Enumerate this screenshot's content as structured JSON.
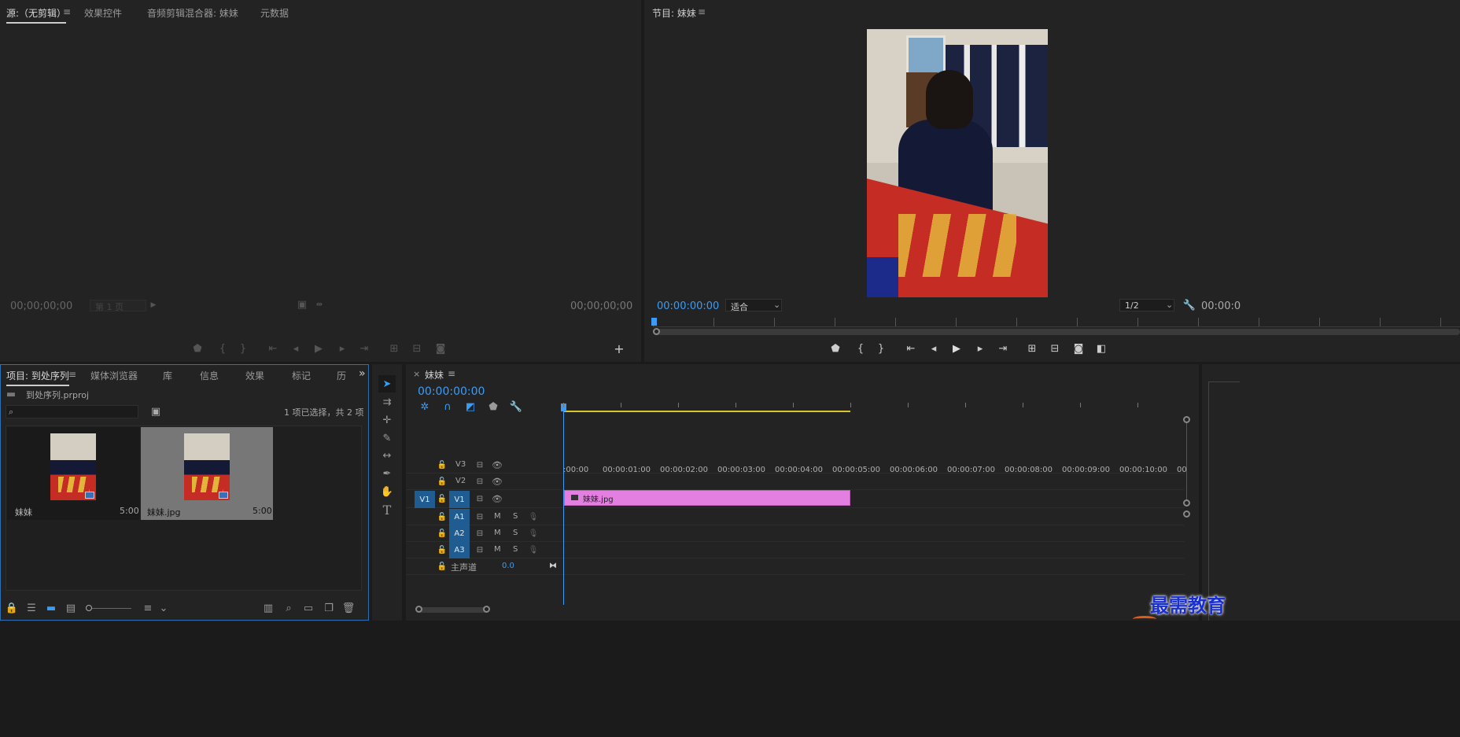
{
  "source_panel": {
    "tabs": [
      "源:（无剪辑）",
      "效果控件",
      "音频剪辑混合器: 妹妹",
      "元数据"
    ],
    "tab_menu_icon": "≡",
    "timecode_left": "00;00;00;00",
    "page_select": "第 1 页",
    "timecode_right": "00;00;00;00"
  },
  "program_panel": {
    "title": "节目: 妹妹",
    "menu_icon": "≡",
    "timecode": "00:00:00:00",
    "fit": "适合",
    "resolution": "1/2",
    "timecode_right": "00:00:0"
  },
  "project_panel": {
    "tabs": [
      "项目: 到处序列",
      "媒体浏览器",
      "库",
      "信息",
      "效果",
      "标记",
      "历"
    ],
    "menu_icon": "≡",
    "more_icon": "»",
    "file": "到处序列.prproj",
    "search_placeholder": "",
    "selection_status": "1 项已选择，共 2 项",
    "items": [
      {
        "name": "妹妹",
        "duration": "5:00",
        "selected": false
      },
      {
        "name": "妹妹.jpg",
        "duration": "5:00",
        "selected": true
      }
    ]
  },
  "timeline": {
    "close": "×",
    "sequence": "妹妹",
    "menu_icon": "≡",
    "timecode": "00:00:00:00",
    "ruler": [
      ":00:00",
      "00:00:01:00",
      "00:00:02:00",
      "00:00:03:00",
      "00:00:04:00",
      "00:00:05:00",
      "00:00:06:00",
      "00:00:07:00",
      "00:00:08:00",
      "00:00:09:00",
      "00:00:10:00",
      "00"
    ],
    "video_tracks": [
      "V3",
      "V2",
      "V1"
    ],
    "source_patch": "V1",
    "audio_tracks": [
      "A1",
      "A2",
      "A3"
    ],
    "mute": "M",
    "solo": "S",
    "master": "主声道",
    "master_value": "0.0",
    "clip_name": "妹妹.jpg"
  },
  "watermark": "最需教育",
  "colors": {
    "accent": "#3b9cf5",
    "clip": "#e27fe0",
    "patch": "#1e5c92",
    "work_area": "#d6c72b"
  }
}
